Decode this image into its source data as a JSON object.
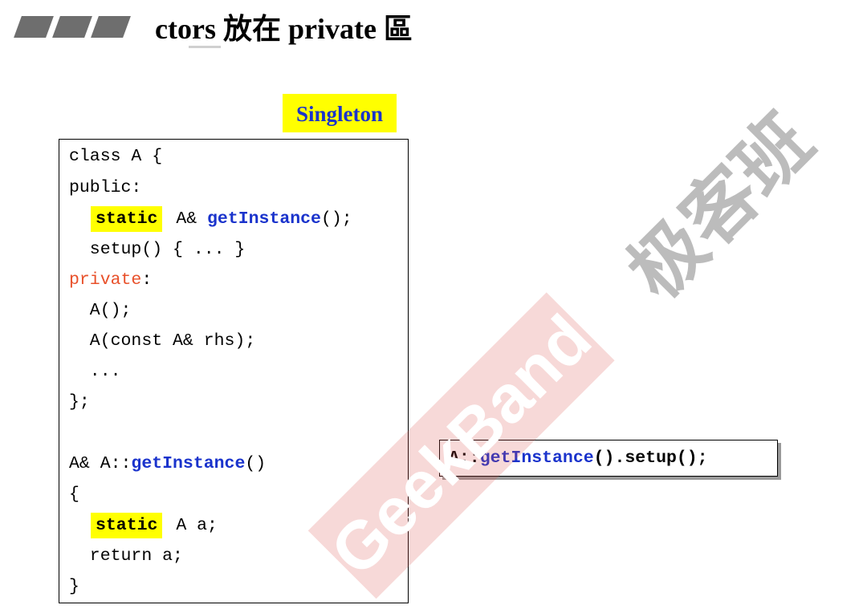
{
  "slide": {
    "title": "ctors 放在 private 區",
    "badge": "Singleton"
  },
  "code": {
    "lines": [
      "class A {",
      "public:",
      "",
      "  setup() { ... }",
      "",
      "  A();",
      "  A(const A& rhs);",
      "  ...",
      "};",
      "",
      "",
      "{",
      "",
      "  return a;",
      "}"
    ],
    "private_label": "private",
    "colon": ":",
    "static_kw": "static",
    "getinstance_decl": {
      "pre": " A& ",
      "fn": "getInstance",
      "post": "();"
    },
    "getinstance_def": {
      "pre": "A& A::",
      "fn": "getInstance",
      "post": "()"
    },
    "static_obj": {
      "rest": " A a;"
    }
  },
  "call": {
    "prefix": "A::",
    "fn": "getInstance",
    "suffix": "().setup();"
  },
  "watermark": {
    "latin": "GeekBand",
    "chinese": "极客班"
  },
  "colors": {
    "highlight": "#ffff00",
    "keyword_blue": "#1a33cc",
    "access_red": "#e8502a",
    "watermark_red": "#d9534f"
  }
}
